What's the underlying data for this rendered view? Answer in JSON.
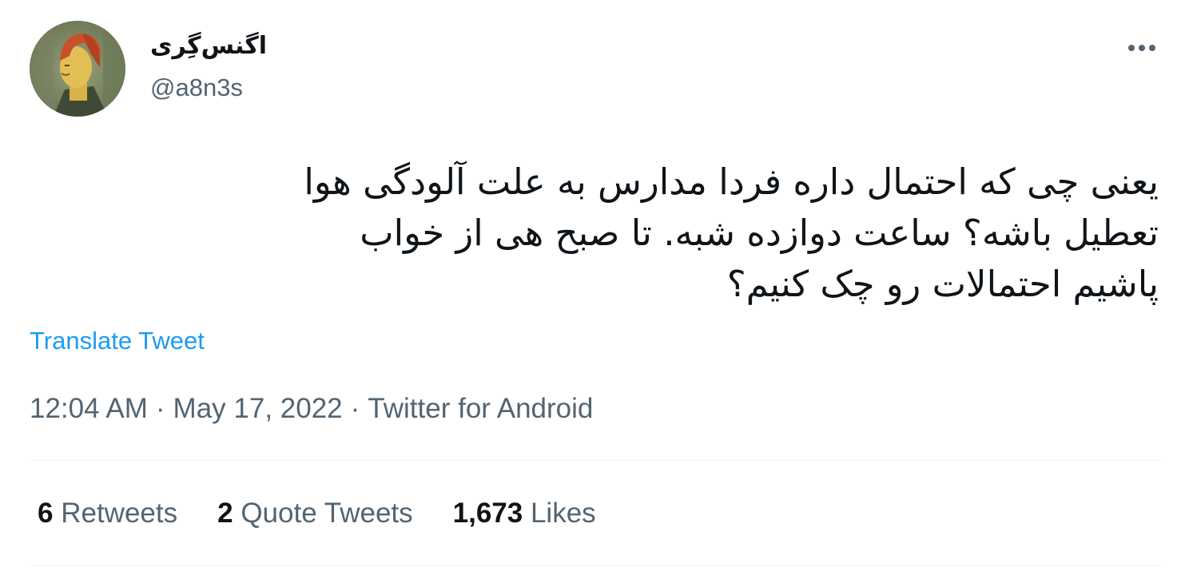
{
  "author": {
    "display_name": "اگنس‌گِری",
    "handle": "@a8n3s"
  },
  "tweet": {
    "text": "یعنی چی که احتمال داره فردا مدارس به علت آلودگی هوا\nتعطیل باشه؟ ساعت دوازده شبه. تا صبح هی از خواب\nپاشیم احتمالات رو چک کنیم؟",
    "translate_label": "Translate Tweet",
    "time": "12:04 AM",
    "date": "May 17, 2022",
    "source": "Twitter for Android",
    "separator": "·"
  },
  "stats": {
    "retweets": {
      "count": "6",
      "label": "Retweets"
    },
    "quote_tweets": {
      "count": "2",
      "label": "Quote Tweets"
    },
    "likes": {
      "count": "1,673",
      "label": "Likes"
    }
  },
  "icons": {
    "more": "more-horizontal-icon"
  },
  "colors": {
    "text": "#0f1419",
    "secondary": "#536471",
    "link": "#1d9bf0",
    "divider": "#eff3f4"
  }
}
